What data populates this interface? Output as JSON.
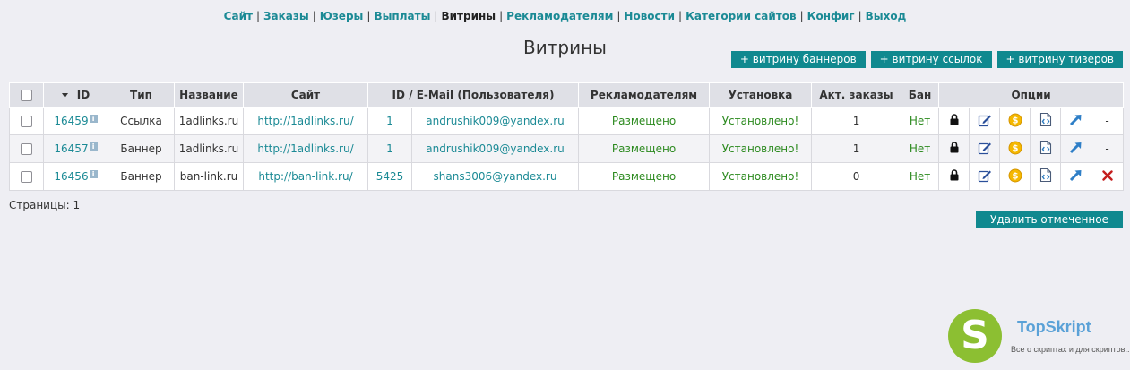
{
  "nav": {
    "items": [
      {
        "label": "Сайт",
        "active": false
      },
      {
        "label": "Заказы",
        "active": false
      },
      {
        "label": "Юзеры",
        "active": false
      },
      {
        "label": "Выплаты",
        "active": false
      },
      {
        "label": "Витрины",
        "active": true
      },
      {
        "label": "Рекламодателям",
        "active": false
      },
      {
        "label": "Новости",
        "active": false
      },
      {
        "label": "Категории сайтов",
        "active": false
      },
      {
        "label": "Конфиг",
        "active": false
      },
      {
        "label": "Выход",
        "active": false
      }
    ],
    "separator": "|"
  },
  "page": {
    "title": "Витрины"
  },
  "actions": {
    "add_banner": "+ витрину баннеров",
    "add_links": "+ витрину ссылок",
    "add_teaser": "+ витрину тизеров"
  },
  "table": {
    "headers": {
      "id": "ID",
      "type": "Тип",
      "name": "Название",
      "site": "Сайт",
      "user": "ID / E-Mail (Пользователя)",
      "advertisers": "Рекламодателям",
      "install": "Установка",
      "active_orders": "Акт. заказы",
      "ban": "Бан",
      "options": "Опции"
    },
    "sort_icon": "sort-desc-icon",
    "info_glyph": "i",
    "rows": [
      {
        "id": "16459",
        "type": "Ссылка",
        "name": "1adlinks.ru",
        "site": "http://1adlinks.ru/",
        "user_id": "1",
        "email": "andrushik009@yandex.ru",
        "advertisers": "Размещено",
        "install": "Установлено!",
        "active_orders": "1",
        "ban": "Нет",
        "delete": "-",
        "deletable": false
      },
      {
        "id": "16457",
        "type": "Баннер",
        "name": "1adlinks.ru",
        "site": "http://1adlinks.ru/",
        "user_id": "1",
        "email": "andrushik009@yandex.ru",
        "advertisers": "Размещено",
        "install": "Установлено!",
        "active_orders": "1",
        "ban": "Нет",
        "delete": "-",
        "deletable": false
      },
      {
        "id": "16456",
        "type": "Баннер",
        "name": "ban-link.ru",
        "site": "http://ban-link.ru/",
        "user_id": "5425",
        "email": "shans3006@yandex.ru",
        "advertisers": "Размещено",
        "install": "Установлено!",
        "active_orders": "0",
        "ban": "Нет",
        "delete": "✕",
        "deletable": true
      }
    ]
  },
  "pagination": {
    "text": "Страницы: 1"
  },
  "bulk": {
    "delete_label": "Удалить отмеченное"
  },
  "watermark": {
    "name": "TopSkript",
    "tagline": "Все о скриптах и для скриптов...",
    "glyph": "S"
  },
  "colors": {
    "accent": "#10898f",
    "link": "#1b8a95",
    "success": "#2c8a1f",
    "danger": "#c41d1d",
    "logo_green": "#8cbf32",
    "logo_blue": "#5aa1d7"
  }
}
